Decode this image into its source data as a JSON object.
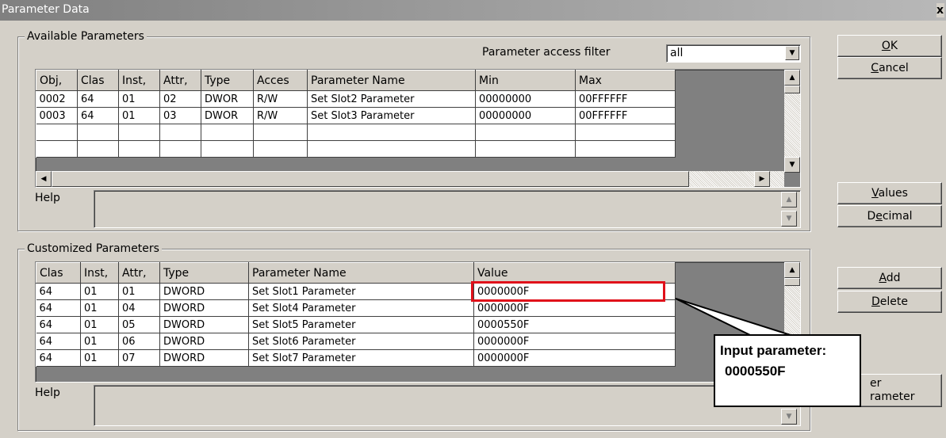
{
  "window": {
    "title": "Parameter Data",
    "close_glyph": "x"
  },
  "available": {
    "group_title": "Available Parameters",
    "filter_label": "Parameter access filter",
    "filter_value": "all",
    "columns": [
      "Obj,",
      "Clas",
      "Inst,",
      "Attr,",
      "Type",
      "Acces",
      "Parameter Name",
      "Min",
      "Max"
    ],
    "rows": [
      [
        "0002",
        "64",
        "01",
        "02",
        "DWOR",
        "R/W",
        "Set Slot2 Parameter",
        "00000000",
        "00FFFFFF"
      ],
      [
        "0003",
        "64",
        "01",
        "03",
        "DWOR",
        "R/W",
        "Set Slot3 Parameter",
        "00000000",
        "00FFFFFF"
      ],
      [
        "",
        "",
        "",
        "",
        "",
        "",
        "",
        "",
        ""
      ],
      [
        "",
        "",
        "",
        "",
        "",
        "",
        "",
        "",
        ""
      ]
    ],
    "help_label": "Help"
  },
  "customized": {
    "group_title": "Customized Parameters",
    "columns": [
      "Clas",
      "Inst,",
      "Attr,",
      "Type",
      "Parameter Name",
      "Value"
    ],
    "rows": [
      [
        "64",
        "01",
        "01",
        "DWORD",
        "Set Slot1 Parameter",
        "0000000F"
      ],
      [
        "64",
        "01",
        "04",
        "DWORD",
        "Set Slot4 Parameter",
        "0000000F"
      ],
      [
        "64",
        "01",
        "05",
        "DWORD",
        "Set Slot5 Parameter",
        "0000550F"
      ],
      [
        "64",
        "01",
        "06",
        "DWORD",
        "Set Slot6 Parameter",
        "0000000F"
      ],
      [
        "64",
        "01",
        "07",
        "DWORD",
        "Set Slot7 Parameter",
        "0000000F"
      ]
    ],
    "help_label": "Help"
  },
  "buttons": {
    "ok": {
      "accel": "O",
      "rest": "K"
    },
    "cancel": {
      "accel": "C",
      "rest": "ancel"
    },
    "values": {
      "accel": "V",
      "rest": "alues"
    },
    "decimal": {
      "pre": "D",
      "accel": "e",
      "rest": "cimal"
    },
    "add": {
      "accel": "A",
      "rest": "dd"
    },
    "delete": {
      "accel": "D",
      "rest": "elete"
    },
    "filter_line1": "er",
    "filter_line2": "rameter"
  },
  "callout": {
    "line1": "Input parameter:",
    "line2": "0000550F",
    "highlight_color": "#e0101a"
  }
}
